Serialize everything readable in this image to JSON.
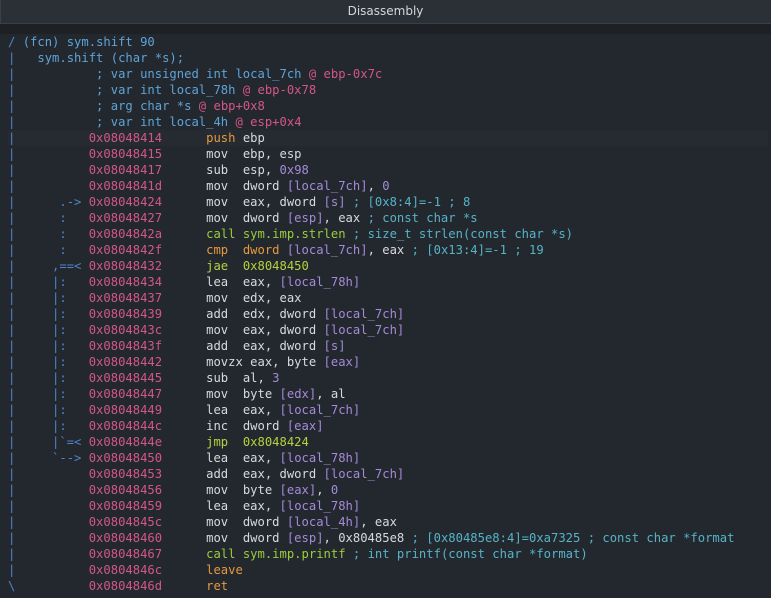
{
  "window": {
    "title": "Disassembly"
  },
  "header": [
    {
      "gutter": "/",
      "segments": [
        [
          "(fcn) ",
          "c-blue"
        ],
        [
          "sym.shift 90",
          "c-blue"
        ]
      ]
    },
    {
      "gutter": "|",
      "segments": [
        [
          "  sym.shift (char *s);",
          "c-blue"
        ]
      ]
    },
    {
      "gutter": "|",
      "segments": [
        [
          "          ; var unsigned int local_7ch ",
          "c-blue"
        ],
        [
          "@",
          "c-pink"
        ],
        [
          " ebp-0x7c",
          "c-pink"
        ]
      ]
    },
    {
      "gutter": "|",
      "segments": [
        [
          "          ; var int local_78h ",
          "c-blue"
        ],
        [
          "@",
          "c-pink"
        ],
        [
          " ebp-0x78",
          "c-pink"
        ]
      ]
    },
    {
      "gutter": "|",
      "segments": [
        [
          "          ; arg char *s ",
          "c-blue"
        ],
        [
          "@",
          "c-pink"
        ],
        [
          " ebp+0x8",
          "c-pink"
        ]
      ]
    },
    {
      "gutter": "|",
      "segments": [
        [
          "          ; var int local_4h ",
          "c-blue"
        ],
        [
          "@",
          "c-pink"
        ],
        [
          " esp+0x4",
          "c-pink"
        ]
      ]
    }
  ],
  "instructions": [
    {
      "gutter": "|          ",
      "addr": "0x08048414",
      "segments": [
        [
          "push",
          "c-orange"
        ],
        [
          " ebp",
          "c-white"
        ]
      ],
      "hl": true
    },
    {
      "gutter": "|          ",
      "addr": "0x08048415",
      "segments": [
        [
          "mov",
          "c-white"
        ],
        [
          "  ebp, esp",
          "c-white"
        ]
      ]
    },
    {
      "gutter": "|          ",
      "addr": "0x08048417",
      "segments": [
        [
          "sub",
          "c-white"
        ],
        [
          "  esp, ",
          "c-white"
        ],
        [
          "0x98",
          "c-purple"
        ]
      ]
    },
    {
      "gutter": "|          ",
      "addr": "0x0804841d",
      "segments": [
        [
          "mov",
          "c-white"
        ],
        [
          "  dword ",
          "c-white"
        ],
        [
          "[local_7ch]",
          "c-purple"
        ],
        [
          ", ",
          "c-white"
        ],
        [
          "0",
          "c-purple"
        ]
      ]
    },
    {
      "gutter": "|      .-> ",
      "addr": "0x08048424",
      "segments": [
        [
          "mov",
          "c-white"
        ],
        [
          "  eax, dword ",
          "c-white"
        ],
        [
          "[s]",
          "c-purple"
        ],
        [
          " ; [0x8:4]=-1 ; 8",
          "c-cyan"
        ]
      ]
    },
    {
      "gutter": "|      :   ",
      "addr": "0x08048427",
      "segments": [
        [
          "mov",
          "c-white"
        ],
        [
          "  dword ",
          "c-white"
        ],
        [
          "[esp]",
          "c-purple"
        ],
        [
          ", eax ",
          "c-white"
        ],
        [
          "; const char *s",
          "c-cyan"
        ]
      ]
    },
    {
      "gutter": "|      :   ",
      "addr": "0x0804842a",
      "segments": [
        [
          "call",
          "c-green"
        ],
        [
          " sym.imp.strlen ",
          "c-green"
        ],
        [
          "; size_t strlen(const char *s)",
          "c-cyan"
        ]
      ]
    },
    {
      "gutter": "|      :   ",
      "addr": "0x0804842f",
      "segments": [
        [
          "cmp",
          "c-orange"
        ],
        [
          "  dword ",
          "c-orange"
        ],
        [
          "[local_7ch]",
          "c-purple"
        ],
        [
          ", eax ",
          "c-white"
        ],
        [
          "; [0x13:4]=-1 ; 19",
          "c-cyan"
        ]
      ]
    },
    {
      "gutter": "|     ,==< ",
      "addr": "0x08048432",
      "segments": [
        [
          "jae",
          "c-yellowgreen"
        ],
        [
          "  0x8048450",
          "c-yellowgreen"
        ]
      ]
    },
    {
      "gutter": "|     |:   ",
      "addr": "0x08048434",
      "segments": [
        [
          "lea",
          "c-white"
        ],
        [
          "  eax, ",
          "c-white"
        ],
        [
          "[local_78h]",
          "c-purple"
        ]
      ]
    },
    {
      "gutter": "|     |:   ",
      "addr": "0x08048437",
      "segments": [
        [
          "mov",
          "c-white"
        ],
        [
          "  edx, eax",
          "c-white"
        ]
      ]
    },
    {
      "gutter": "|     |:   ",
      "addr": "0x08048439",
      "segments": [
        [
          "add",
          "c-white"
        ],
        [
          "  edx, dword ",
          "c-white"
        ],
        [
          "[local_7ch]",
          "c-purple"
        ]
      ]
    },
    {
      "gutter": "|     |:   ",
      "addr": "0x0804843c",
      "segments": [
        [
          "mov",
          "c-white"
        ],
        [
          "  eax, dword ",
          "c-white"
        ],
        [
          "[local_7ch]",
          "c-purple"
        ]
      ]
    },
    {
      "gutter": "|     |:   ",
      "addr": "0x0804843f",
      "segments": [
        [
          "add",
          "c-white"
        ],
        [
          "  eax, dword ",
          "c-white"
        ],
        [
          "[s]",
          "c-purple"
        ]
      ]
    },
    {
      "gutter": "|     |:   ",
      "addr": "0x08048442",
      "segments": [
        [
          "movzx",
          "c-white"
        ],
        [
          " eax, byte ",
          "c-white"
        ],
        [
          "[eax]",
          "c-purple"
        ]
      ]
    },
    {
      "gutter": "|     |:   ",
      "addr": "0x08048445",
      "segments": [
        [
          "sub",
          "c-white"
        ],
        [
          "  al, ",
          "c-white"
        ],
        [
          "3",
          "c-purple"
        ]
      ]
    },
    {
      "gutter": "|     |:   ",
      "addr": "0x08048447",
      "segments": [
        [
          "mov",
          "c-white"
        ],
        [
          "  byte ",
          "c-white"
        ],
        [
          "[edx]",
          "c-purple"
        ],
        [
          ", al",
          "c-white"
        ]
      ]
    },
    {
      "gutter": "|     |:   ",
      "addr": "0x08048449",
      "segments": [
        [
          "lea",
          "c-white"
        ],
        [
          "  eax, ",
          "c-white"
        ],
        [
          "[local_7ch]",
          "c-purple"
        ]
      ]
    },
    {
      "gutter": "|     |:   ",
      "addr": "0x0804844c",
      "segments": [
        [
          "inc",
          "c-white"
        ],
        [
          "  dword ",
          "c-white"
        ],
        [
          "[eax]",
          "c-purple"
        ]
      ]
    },
    {
      "gutter": "|     |`=< ",
      "addr": "0x0804844e",
      "segments": [
        [
          "jmp",
          "c-yellowgreen"
        ],
        [
          "  0x8048424",
          "c-yellowgreen"
        ]
      ]
    },
    {
      "gutter": "|     `--> ",
      "addr": "0x08048450",
      "segments": [
        [
          "lea",
          "c-white"
        ],
        [
          "  eax, ",
          "c-white"
        ],
        [
          "[local_78h]",
          "c-purple"
        ]
      ]
    },
    {
      "gutter": "|          ",
      "addr": "0x08048453",
      "segments": [
        [
          "add",
          "c-white"
        ],
        [
          "  eax, dword ",
          "c-white"
        ],
        [
          "[local_7ch]",
          "c-purple"
        ]
      ]
    },
    {
      "gutter": "|          ",
      "addr": "0x08048456",
      "segments": [
        [
          "mov",
          "c-white"
        ],
        [
          "  byte ",
          "c-white"
        ],
        [
          "[eax]",
          "c-purple"
        ],
        [
          ", ",
          "c-white"
        ],
        [
          "0",
          "c-purple"
        ]
      ]
    },
    {
      "gutter": "|          ",
      "addr": "0x08048459",
      "segments": [
        [
          "lea",
          "c-white"
        ],
        [
          "  eax, ",
          "c-white"
        ],
        [
          "[local_78h]",
          "c-purple"
        ]
      ]
    },
    {
      "gutter": "|          ",
      "addr": "0x0804845c",
      "segments": [
        [
          "mov",
          "c-white"
        ],
        [
          "  dword ",
          "c-white"
        ],
        [
          "[local_4h]",
          "c-purple"
        ],
        [
          ", eax",
          "c-white"
        ]
      ]
    },
    {
      "gutter": "|          ",
      "addr": "0x08048460",
      "segments": [
        [
          "mov",
          "c-white"
        ],
        [
          "  dword ",
          "c-white"
        ],
        [
          "[esp]",
          "c-purple"
        ],
        [
          ", 0x80485e8 ",
          "c-white"
        ],
        [
          "; [0x80485e8:4]=0xa7325 ; const char *format",
          "c-cyan"
        ]
      ]
    },
    {
      "gutter": "|          ",
      "addr": "0x08048467",
      "segments": [
        [
          "call",
          "c-green"
        ],
        [
          " sym.imp.printf ",
          "c-green"
        ],
        [
          "; int printf(const char *format)",
          "c-cyan"
        ]
      ]
    },
    {
      "gutter": "|          ",
      "addr": "0x0804846c",
      "segments": [
        [
          "leave",
          "c-orange"
        ]
      ]
    },
    {
      "gutter": "\\          ",
      "addr": "0x0804846d",
      "segments": [
        [
          "ret",
          "c-orange"
        ]
      ]
    }
  ]
}
